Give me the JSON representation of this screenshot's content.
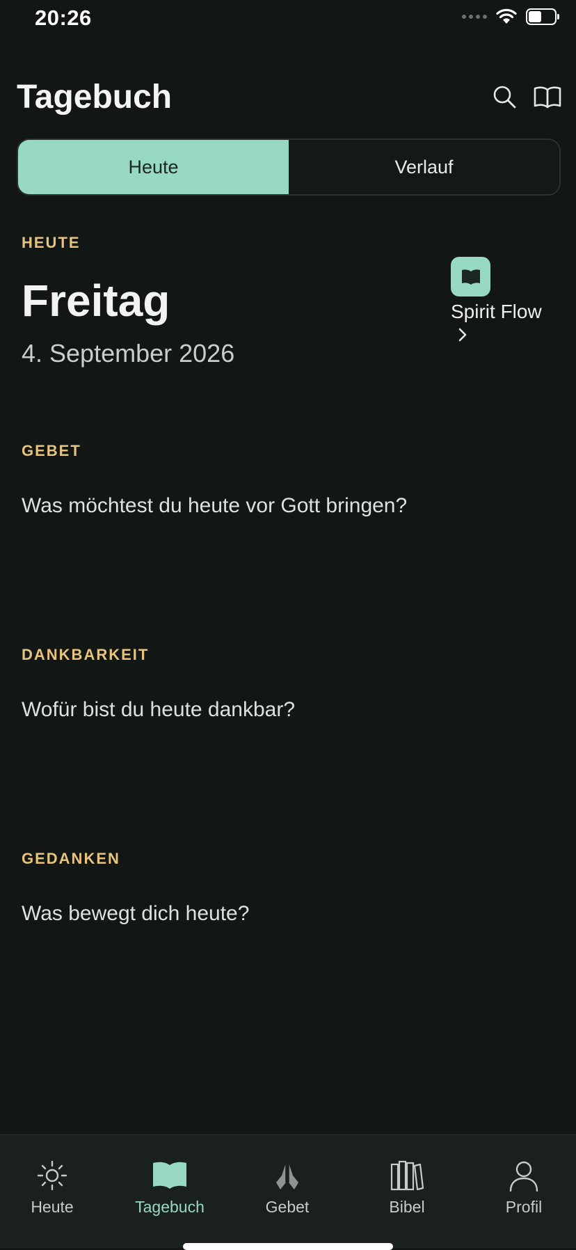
{
  "status": {
    "time": "20:26"
  },
  "header": {
    "title": "Tagebuch",
    "search_icon": "search-icon",
    "book_icon": "book-open-icon"
  },
  "segments": [
    {
      "label": "Heute",
      "active": true
    },
    {
      "label": "Verlauf",
      "active": false
    }
  ],
  "today": {
    "section_label": "HEUTE",
    "day": "Freitag",
    "date": "4. September 2026"
  },
  "spirit_flow": {
    "label": "Spirit Flow",
    "icon": "book-icon"
  },
  "journal": [
    {
      "label": "GEBET",
      "prompt": "Was möchtest du heute vor Gott bringen?"
    },
    {
      "label": "DANKBARKEIT",
      "prompt": "Wofür bist du heute dankbar?"
    },
    {
      "label": "GEDANKEN",
      "prompt": "Was bewegt dich heute?"
    }
  ],
  "tabbar": [
    {
      "label": "Heute",
      "icon": "sun-icon",
      "active": false
    },
    {
      "label": "Tagebuch",
      "icon": "book-icon",
      "active": true
    },
    {
      "label": "Gebet",
      "icon": "praying-hands-icon",
      "active": false
    },
    {
      "label": "Bibel",
      "icon": "books-icon",
      "active": false
    },
    {
      "label": "Profil",
      "icon": "person-icon",
      "active": false
    }
  ],
  "colors": {
    "background": "#121614",
    "accent": "#98d9c3",
    "section_label": "#e7c47e",
    "tabbar": "#1a201d"
  }
}
